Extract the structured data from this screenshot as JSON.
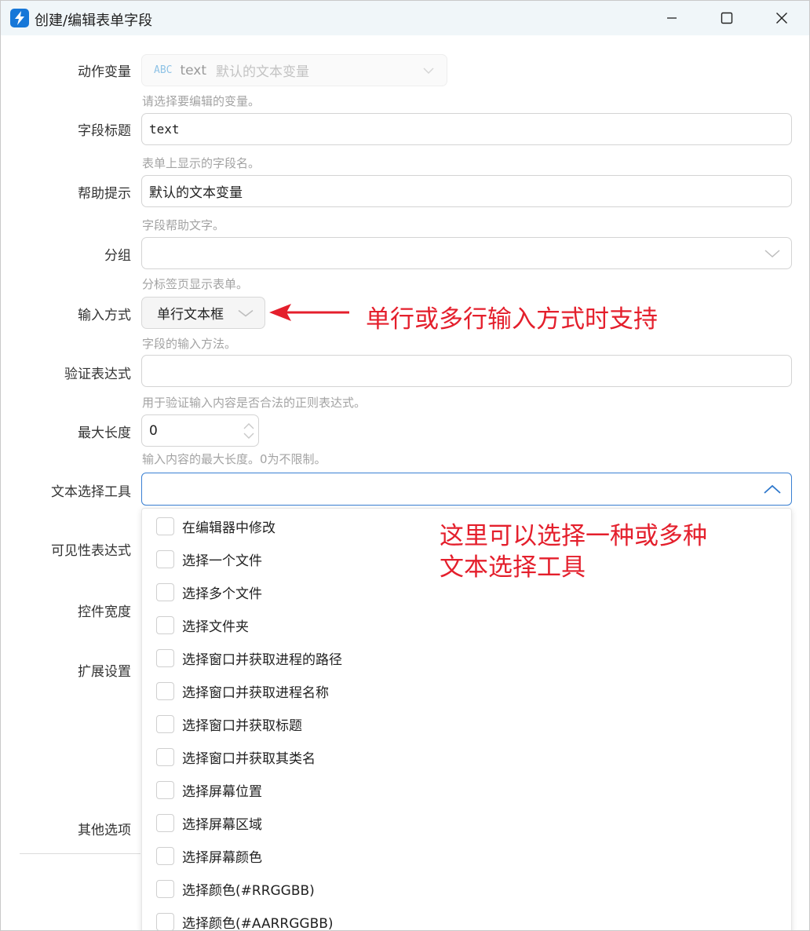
{
  "window": {
    "title": "创建/编辑表单字段",
    "app_icon": "lightning-icon",
    "accent_color": "#1677d8"
  },
  "form": {
    "action_var": {
      "label": "动作变量",
      "type_badge": "ABC",
      "name": "text",
      "desc": "默认的文本变量",
      "hint": "请选择要编辑的变量。"
    },
    "field_title": {
      "label": "字段标题",
      "value": "text",
      "hint": "表单上显示的字段名。"
    },
    "help_tip": {
      "label": "帮助提示",
      "value": "默认的文本变量",
      "hint": "字段帮助文字。"
    },
    "group": {
      "label": "分组",
      "value": "",
      "hint": "分标签页显示表单。"
    },
    "input_mode": {
      "label": "输入方式",
      "value": "单行文本框",
      "hint": "字段的输入方法。"
    },
    "validation": {
      "label": "验证表达式",
      "value": "",
      "hint": "用于验证输入内容是否合法的正则表达式。"
    },
    "max_length": {
      "label": "最大长度",
      "value": "0",
      "hint": "输入内容的最大长度。0为不限制。"
    },
    "text_tools": {
      "label": "文本选择工具",
      "value": ""
    },
    "visibility": {
      "label": "可见性表达式"
    },
    "control_width": {
      "label": "控件宽度"
    },
    "ext_settings": {
      "label": "扩展设置"
    },
    "other_options": {
      "label": "其他选项"
    }
  },
  "dropdown": {
    "items": [
      {
        "label": "在编辑器中修改",
        "checked": false
      },
      {
        "label": "选择一个文件",
        "checked": false
      },
      {
        "label": "选择多个文件",
        "checked": false
      },
      {
        "label": "选择文件夹",
        "checked": false
      },
      {
        "label": "选择窗口并获取进程的路径",
        "checked": false
      },
      {
        "label": "选择窗口并获取进程名称",
        "checked": false
      },
      {
        "label": "选择窗口并获取标题",
        "checked": false
      },
      {
        "label": "选择窗口并获取其类名",
        "checked": false
      },
      {
        "label": "选择屏幕位置",
        "checked": false
      },
      {
        "label": "选择屏幕区域",
        "checked": false
      },
      {
        "label": "选择屏幕颜色",
        "checked": false
      },
      {
        "label": "选择颜色(#RRGGBB)",
        "checked": false
      },
      {
        "label": "选择颜色(#AARRGGBB)",
        "checked": false
      }
    ]
  },
  "annotations": {
    "arrow_note": "单行或多行输入方式时支持",
    "dropdown_note_line1": "这里可以选择一种或多种",
    "dropdown_note_line2": "文本选择工具",
    "color": "#e41f2c"
  }
}
